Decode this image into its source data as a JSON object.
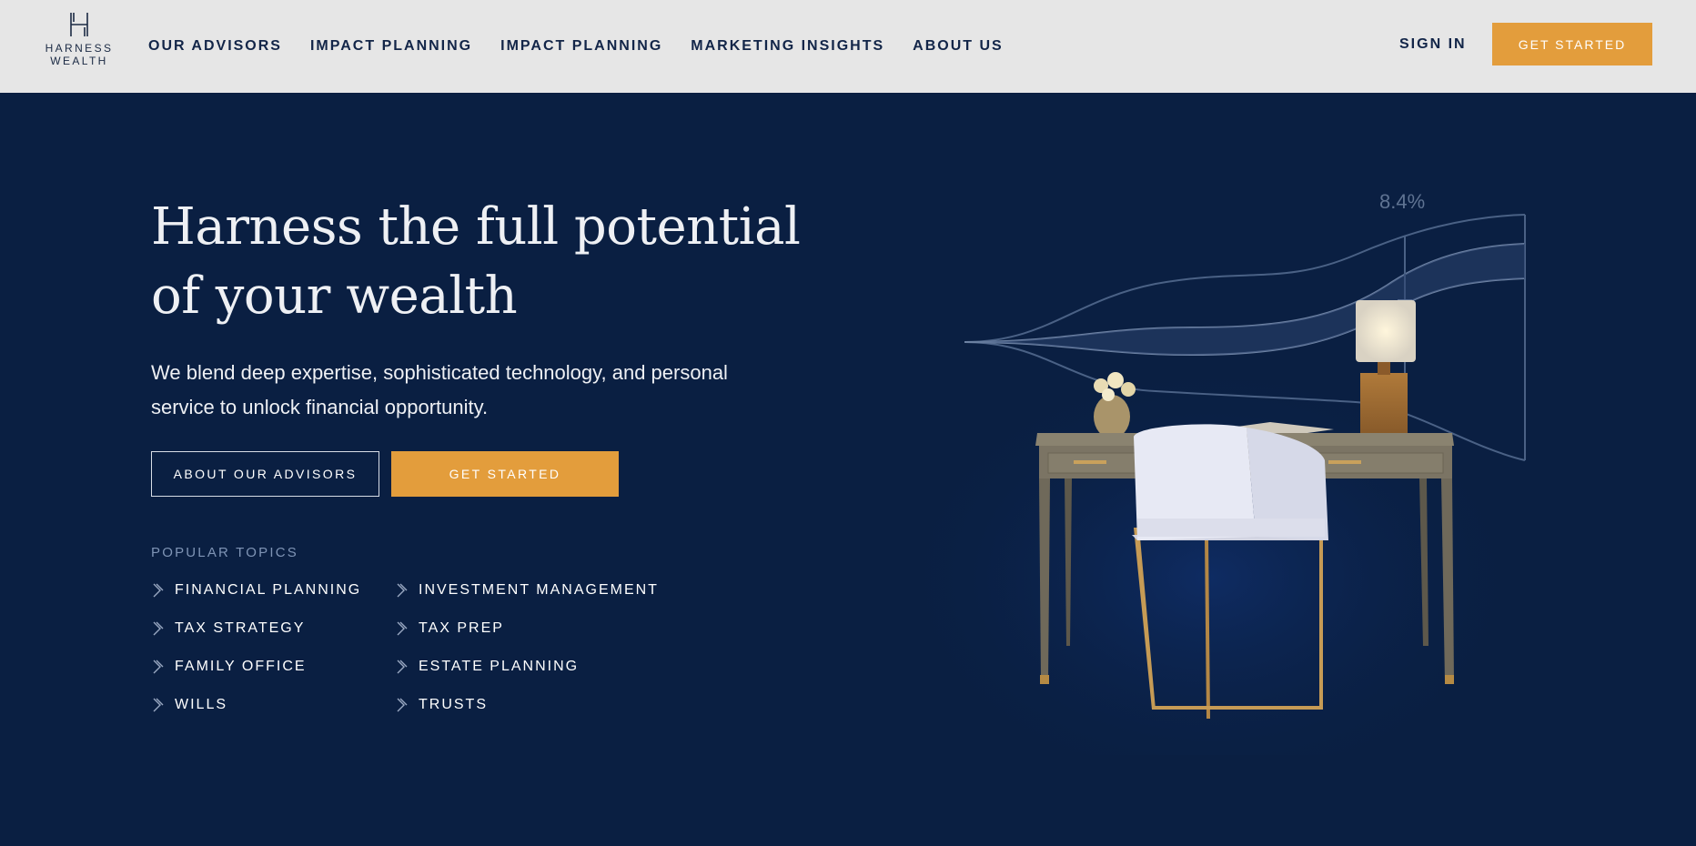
{
  "brand": {
    "logo_line1": "HARNESS",
    "logo_line2": "WEALTH"
  },
  "nav": {
    "links": [
      "OUR ADVISORS",
      "IMPACT PLANNING",
      "IMPACT PLANNING",
      "MARKETING INSIGHTS",
      "ABOUT US"
    ],
    "signin": "SIGN IN",
    "cta": "GET STARTED"
  },
  "hero": {
    "title_line1": "Harness the full potential",
    "title_line2": "of your wealth",
    "subtitle_line1": "We blend deep expertise, sophisticated technology, and personal",
    "subtitle_line2": "service to unlock financial opportunity.",
    "btn_advisors": "ABOUT OUR ADVISORS",
    "btn_start": "GET STARTED"
  },
  "topics": {
    "label": "POPULAR TOPICS",
    "left": [
      "FINANCIAL PLANNING",
      "TAX STRATEGY",
      "FAMILY OFFICE",
      "WILLS"
    ],
    "right": [
      "INVESTMENT MANAGEMENT",
      "TAX PREP",
      "ESTATE PLANNING",
      "TRUSTS"
    ]
  },
  "illustration": {
    "growth_label": "8.4%"
  },
  "colors": {
    "nav_bg": "#e6e6e6",
    "hero_bg": "#0a1f42",
    "accent": "#e39d3c",
    "nav_text": "#122548"
  }
}
